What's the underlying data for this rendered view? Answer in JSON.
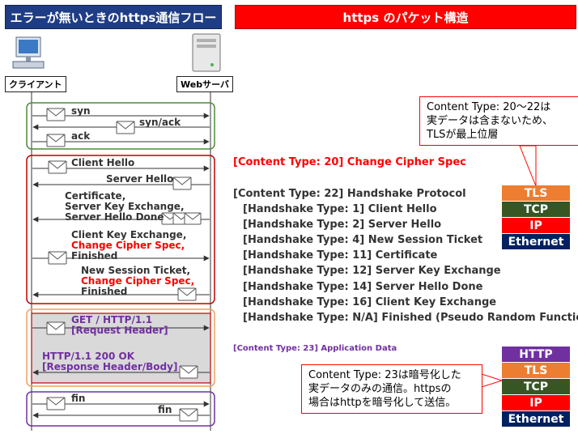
{
  "left_title": "エラーが無いときのhttps通信フロー",
  "right_title": "https のパケット構造",
  "actors": {
    "client": "クライアント",
    "server": "Webサーバ"
  },
  "flow": {
    "syn": "syn",
    "synack": "syn/ack",
    "ack": "ack",
    "client_hello": "Client Hello",
    "server_hello": "Server Hello",
    "cert_line1": "Certificate,",
    "cert_line2": "Server Key Exchange,",
    "cert_line3": "Server Hello Done",
    "cke_line1": "Client Key Exchange,",
    "cke_line2": "Change Cipher Spec,",
    "cke_line3": "Finished",
    "nst_line1": "New Session Ticket,",
    "nst_line2": "Change Cipher Spec,",
    "nst_line3": "Finished",
    "get_line1": "GET / HTTP/1.1",
    "get_line2": "[Request Header]",
    "resp_line1": "HTTP/1.1 200 OK",
    "resp_line2": "[Response Header/Body]",
    "fin_client": "fin",
    "fin_server": "fin"
  },
  "packet": {
    "ccs": "[Content Type: 20] Change Cipher Spec",
    "handshake": "[Content Type: 22] Handshake Protocol",
    "hs_items": [
      "[Handshake Type: 1] Client Hello",
      "[Handshake Type: 2] Server Hello",
      "[Handshake Type: 4] New Session Ticket",
      "[Handshake Type: 11] Certificate",
      "[Handshake Type: 12] Server Key Exchange",
      "[Handshake Type: 14] Server Hello Done",
      "[Handshake Type: 16] Client Key Exchange",
      "[Handshake Type: N/A] Finished (Pseudo Random Function)"
    ],
    "appdata": "[Content Type: 23] Application  Data"
  },
  "stack_top": [
    "TLS",
    "TCP",
    "IP",
    "Ethernet"
  ],
  "stack_bottom": [
    "HTTP",
    "TLS",
    "TCP",
    "IP",
    "Ethernet"
  ],
  "stack_colors": {
    "HTTP": "#7030a0",
    "TLS": "#ed7d31",
    "TCP": "#375623",
    "IP": "#ff0000",
    "Ethernet": "#002060"
  },
  "callout_top": [
    "Content Type: 20～22は",
    "実データは含まないため、",
    "TLSが最上位層"
  ],
  "callout_bottom": [
    "Content Type: 23は暗号化した",
    "実データのみの通信。httpsの",
    "場合はhttpを暗号化して送信。"
  ]
}
